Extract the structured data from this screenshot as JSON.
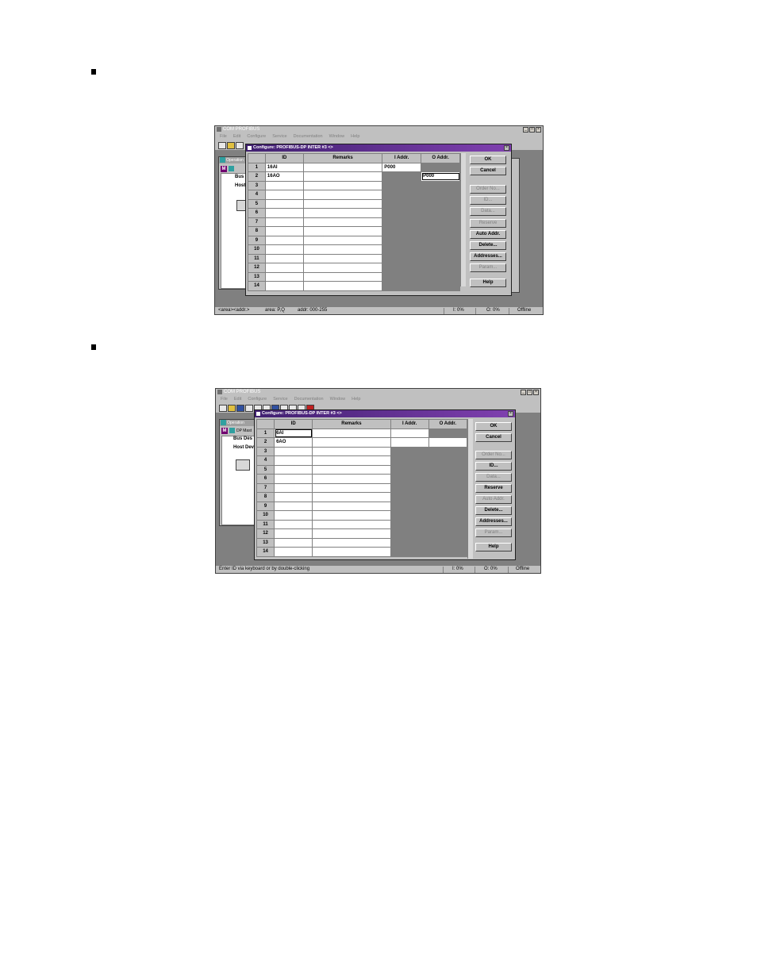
{
  "screenshots": [
    {
      "app_title": "COM PROFIBUS",
      "menu": [
        "File",
        "Edit",
        "Configure",
        "Service",
        "Documentation",
        "Window",
        "Help"
      ],
      "bg_window": {
        "title": "Operation",
        "lines": [
          "Bus C",
          "Host"
        ]
      },
      "dialog": {
        "title": "Configure: PROFIBUS-DP INTER  #3  <>",
        "columns": [
          "ID",
          "Remarks",
          "I Addr.",
          "O Addr."
        ],
        "rows": [
          {
            "n": "1",
            "id": "16AI",
            "remarks": "",
            "iaddr": "P000",
            "oaddr": ""
          },
          {
            "n": "2",
            "id": "16AO",
            "remarks": "",
            "iaddr": "",
            "oaddr": "P000"
          },
          {
            "n": "3"
          },
          {
            "n": "4"
          },
          {
            "n": "5"
          },
          {
            "n": "6"
          },
          {
            "n": "7"
          },
          {
            "n": "8"
          },
          {
            "n": "9"
          },
          {
            "n": "10"
          },
          {
            "n": "11"
          },
          {
            "n": "12"
          },
          {
            "n": "13"
          },
          {
            "n": "14"
          }
        ],
        "buttons": [
          {
            "label": "OK",
            "enabled": true
          },
          {
            "label": "Cancel",
            "enabled": true
          },
          {
            "label": "Order No...",
            "enabled": false
          },
          {
            "label": "ID...",
            "enabled": false
          },
          {
            "label": "Data...",
            "enabled": false
          },
          {
            "label": "Reserve",
            "enabled": false
          },
          {
            "label": "Auto Addr.",
            "enabled": true
          },
          {
            "label": "Delete...",
            "enabled": true
          },
          {
            "label": "Addresses...",
            "enabled": true
          },
          {
            "label": "Param...",
            "enabled": false
          },
          {
            "label": "Help",
            "enabled": true
          }
        ]
      },
      "status": {
        "left": "<area><addr.>",
        "mid1": "area: P,Q",
        "mid2": "addr: 000-255",
        "i": "I: 0%",
        "o": "O: 0%",
        "mode": "Offline"
      }
    },
    {
      "app_title": "COM PROFIBUS",
      "menu": [
        "File",
        "Edit",
        "Configure",
        "Service",
        "Documentation",
        "Window",
        "Help"
      ],
      "bg_window": {
        "title": "Operation",
        "sub": "DP Mast",
        "lines": [
          "Bus Des",
          "Host Dev"
        ]
      },
      "dialog": {
        "title": "Configure: PROFIBUS-DP INTER  #3  <>",
        "columns": [
          "ID",
          "Remarks",
          "I Addr.",
          "O Addr."
        ],
        "rows": [
          {
            "n": "1",
            "id": "6AI",
            "remarks": "",
            "iaddr": "",
            "oaddr": ""
          },
          {
            "n": "2",
            "id": "6AO",
            "remarks": "",
            "iaddr": "",
            "oaddr": ""
          },
          {
            "n": "3"
          },
          {
            "n": "4"
          },
          {
            "n": "5"
          },
          {
            "n": "6"
          },
          {
            "n": "7"
          },
          {
            "n": "8"
          },
          {
            "n": "9"
          },
          {
            "n": "10"
          },
          {
            "n": "11"
          },
          {
            "n": "12"
          },
          {
            "n": "13"
          },
          {
            "n": "14"
          }
        ],
        "buttons": [
          {
            "label": "OK",
            "enabled": true
          },
          {
            "label": "Cancel",
            "enabled": true
          },
          {
            "label": "Order No...",
            "enabled": false
          },
          {
            "label": "ID...",
            "enabled": true
          },
          {
            "label": "Data...",
            "enabled": false
          },
          {
            "label": "Reserve",
            "enabled": true
          },
          {
            "label": "Auto Addr.",
            "enabled": false
          },
          {
            "label": "Delete...",
            "enabled": true
          },
          {
            "label": "Addresses...",
            "enabled": true
          },
          {
            "label": "Param...",
            "enabled": false
          },
          {
            "label": "Help",
            "enabled": true
          }
        ]
      },
      "status": {
        "left": "Enter ID via keyboard or by double-clicking",
        "i": "I: 0%",
        "o": "O: 0%",
        "mode": "Offline"
      }
    }
  ]
}
